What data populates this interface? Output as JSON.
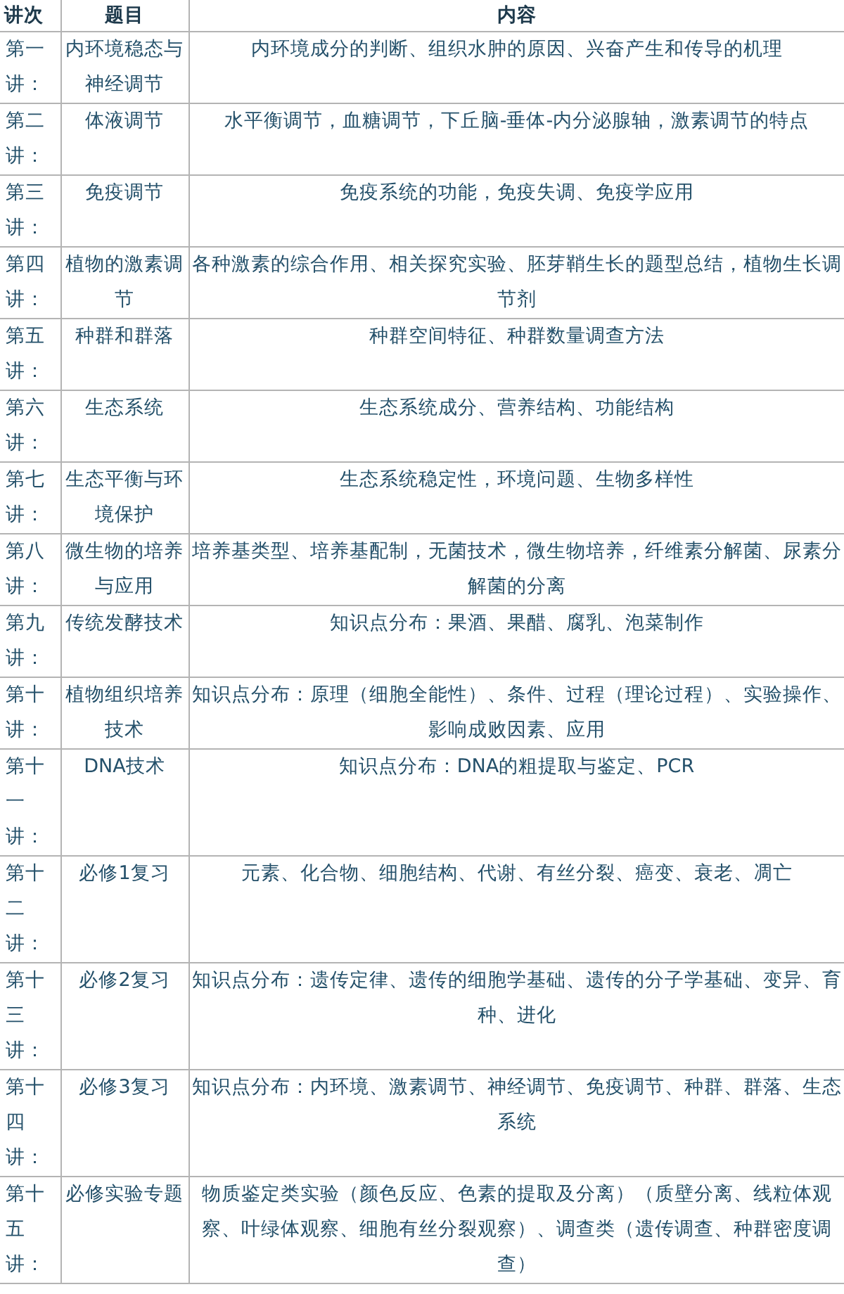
{
  "table": {
    "columns": [
      "讲次",
      "题目",
      "内容"
    ],
    "rows": [
      {
        "lecture": "第一讲：",
        "topic": "内环境稳态与神经调节",
        "content": "内环境成分的判断、组织水肿的原因、兴奋产生和传导的机理"
      },
      {
        "lecture": "第二讲：",
        "topic": "体液调节",
        "content": "水平衡调节，血糖调节，下丘脑-垂体-内分泌腺轴，激素调节的特点"
      },
      {
        "lecture": "第三讲：",
        "topic": "免疫调节",
        "content": "免疫系统的功能，免疫失调、免疫学应用"
      },
      {
        "lecture": "第四讲：",
        "topic": "植物的激素调节",
        "content": "各种激素的综合作用、相关探究实验、胚芽鞘生长的题型总结，植物生长调节剂"
      },
      {
        "lecture": "第五讲：",
        "topic": "种群和群落",
        "content": "种群空间特征、种群数量调查方法"
      },
      {
        "lecture": "第六讲：",
        "topic": "生态系统",
        "content": "生态系统成分、营养结构、功能结构"
      },
      {
        "lecture": "第七讲：",
        "topic": "生态平衡与环境保护",
        "content": "生态系统稳定性，环境问题、生物多样性"
      },
      {
        "lecture": "第八讲：",
        "topic": "微生物的培养与应用",
        "content": "培养基类型、培养基配制，无菌技术，微生物培养，纤维素分解菌、尿素分解菌的分离"
      },
      {
        "lecture": "第九讲：",
        "topic": "传统发酵技术",
        "content": "知识点分布：果酒、果醋、腐乳、泡菜制作"
      },
      {
        "lecture": "第十讲：",
        "topic": "植物组织培养技术",
        "content": "知识点分布：原理（细胞全能性）、条件、过程（理论过程）、实验操作、影响成败因素、应用"
      },
      {
        "lecture": "第十一讲：",
        "topic": "DNA技术",
        "content": "知识点分布：DNA的粗提取与鉴定、PCR"
      },
      {
        "lecture": "第十二讲：",
        "topic": "必修1复习",
        "content": "元素、化合物、细胞结构、代谢、有丝分裂、癌变、衰老、凋亡"
      },
      {
        "lecture": "第十三讲：",
        "topic": "必修2复习",
        "content": "知识点分布：遗传定律、遗传的细胞学基础、遗传的分子学基础、变异、育种、进化"
      },
      {
        "lecture": "第十四讲：",
        "topic": "必修3复习",
        "content": "知识点分布：内环境、激素调节、神经调节、免疫调节、种群、群落、生态系统"
      },
      {
        "lecture": "第十五讲：",
        "topic": "必修实验专题",
        "content": "物质鉴定类实验（颜色反应、色素的提取及分离）（质壁分离、线粒体观察、叶绿体观察、细胞有丝分裂观察）、调查类（遗传调查、种群密度调查）"
      }
    ]
  }
}
